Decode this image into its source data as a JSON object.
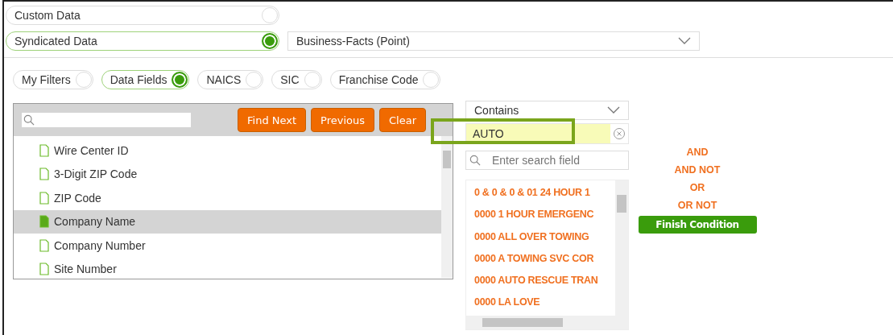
{
  "sources": [
    {
      "label": "Custom Data",
      "selected": false
    },
    {
      "label": "Syndicated Data",
      "selected": true
    }
  ],
  "dataset": {
    "value": "Business-Facts (Point)"
  },
  "filter_tabs": [
    {
      "label": "My Filters",
      "selected": false
    },
    {
      "label": "Data Fields",
      "selected": true
    },
    {
      "label": "NAICS",
      "selected": false
    },
    {
      "label": "SIC",
      "selected": false
    },
    {
      "label": "Franchise Code",
      "selected": false
    }
  ],
  "field_search": {
    "buttons": [
      "Find Next",
      "Previous",
      "Clear"
    ]
  },
  "fields": [
    {
      "label": "Wire Center ID",
      "selected": false
    },
    {
      "label": "3-Digit ZIP Code",
      "selected": false
    },
    {
      "label": "ZIP Code",
      "selected": false
    },
    {
      "label": "Company Name",
      "selected": true
    },
    {
      "label": "Company Number",
      "selected": false
    },
    {
      "label": "Site Number",
      "selected": false
    }
  ],
  "operator": {
    "value": "Contains"
  },
  "value_field": {
    "value": "AUTO"
  },
  "value_search": {
    "placeholder": "Enter search field"
  },
  "values": [
    "0 & 0 & 0 & 01 24 HOUR 1",
    "0000 1 HOUR EMERGENC",
    "0000 ALL OVER TOWING",
    "0000 A TOWING SVC COR",
    "0000 AUTO RESCUE TRAN",
    "0000 LA LOVE"
  ],
  "logic": [
    "AND",
    "AND NOT",
    "OR",
    "OR NOT"
  ],
  "finish_button": "Finish Condition"
}
